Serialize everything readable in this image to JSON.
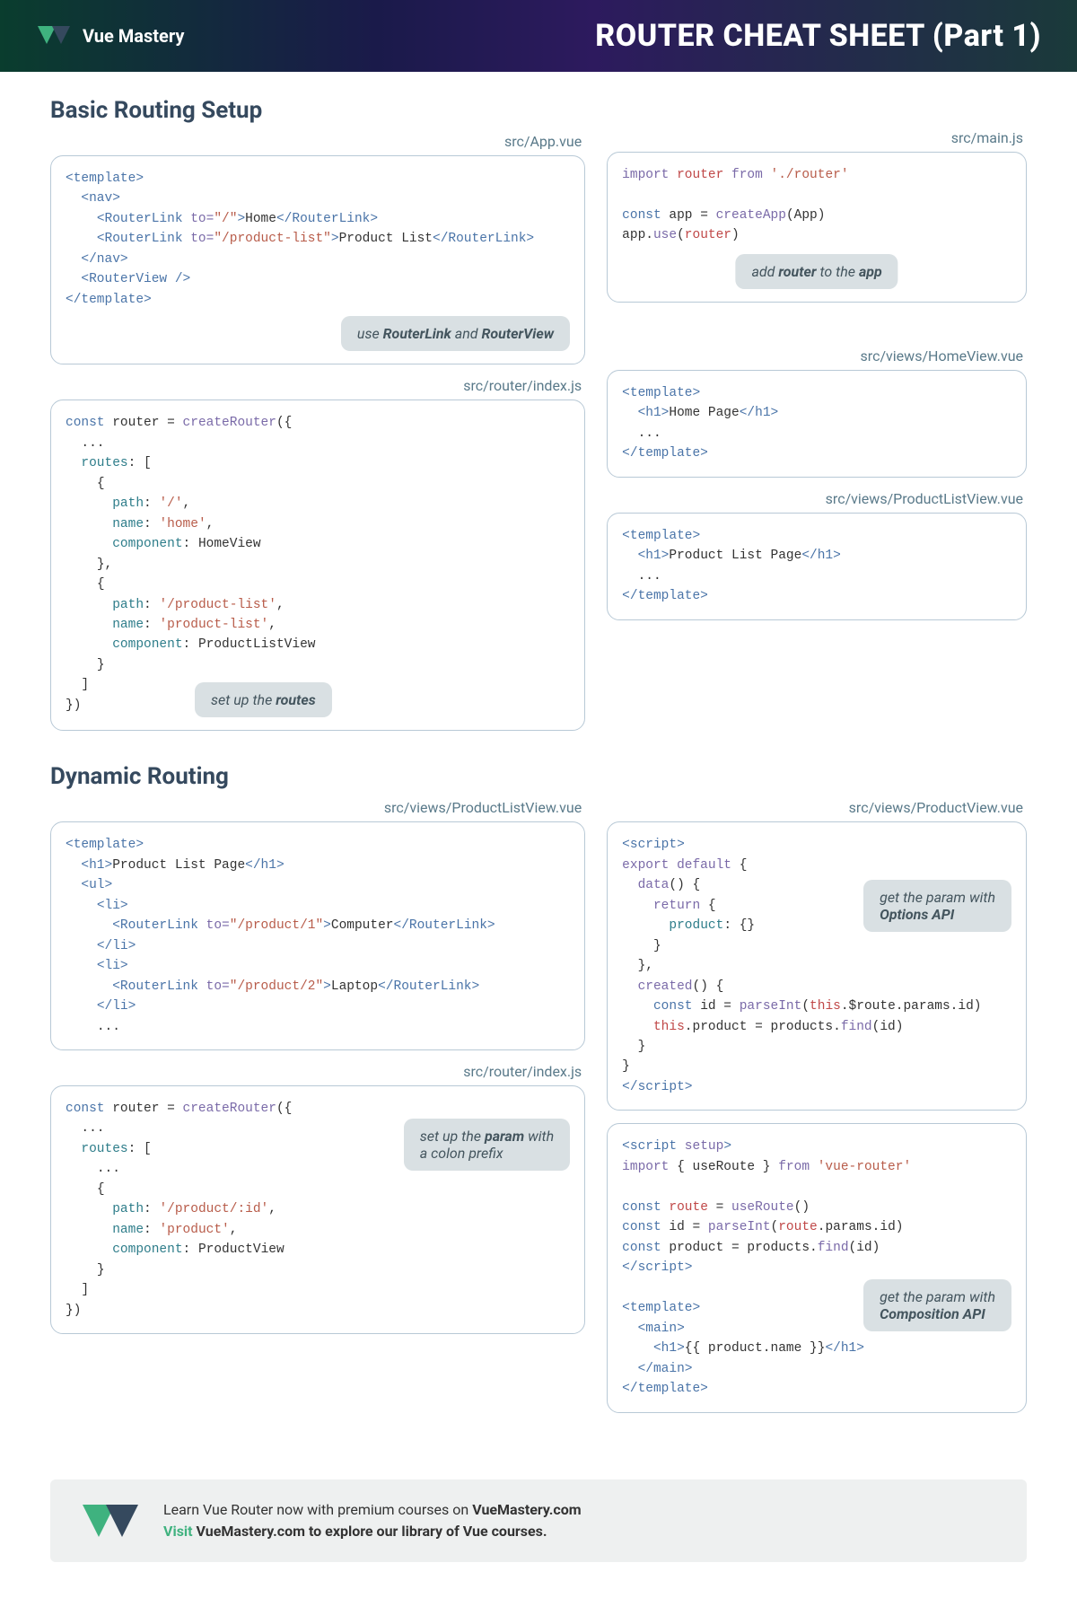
{
  "header": {
    "brand": "Vue Mastery",
    "title": "ROUTER CHEAT SHEET  (Part 1)"
  },
  "basic": {
    "heading": "Basic Routing Setup",
    "files": {
      "app": "src/App.vue",
      "main": "src/main.js",
      "router": "src/router/index.js",
      "home": "src/views/HomeView.vue",
      "plv": "src/views/ProductListView.vue"
    },
    "code": {
      "app": "<template>\n  <nav>\n    <RouterLink to=\"/\">Home</RouterLink>\n    <RouterLink to=\"/product-list\">Product List</RouterLink>\n  </nav>\n  <RouterView />\n</template>",
      "main": "import router from './router'\n\nconst app = createApp(App)\napp.use(router)",
      "router": "const router = createRouter({\n  ...\n  routes: [\n    {\n      path: '/',\n      name: 'home',\n      component: HomeView\n    },\n    {\n      path: '/product-list',\n      name: 'product-list',\n      component: ProductListView\n    }\n  ]\n})",
      "home": "<template>\n  <h1>Home Page</h1>\n  ...\n</template>",
      "plv": "<template>\n  <h1>Product List Page</h1>\n  ...\n</template>"
    },
    "callouts": {
      "rl": "use RouterLink and RouterView",
      "add": "add router to the app",
      "routes": "set up the routes"
    }
  },
  "dynamic": {
    "heading": "Dynamic Routing",
    "files": {
      "plv": "src/views/ProductListView.vue",
      "pv": "src/views/ProductView.vue",
      "router": "src/router/index.js"
    },
    "code": {
      "list": "<template>\n  <h1>Product List Page</h1>\n  <ul>\n    <li>\n      <RouterLink to=\"/product/1\">Computer</RouterLink>\n    </li>\n    <li>\n      <RouterLink to=\"/product/2\">Laptop</RouterLink>\n    </li>\n    ...",
      "router": "const router = createRouter({\n  ...\n  routes: [\n    ...\n    {\n      path: '/product/:id',\n      name: 'product',\n      component: ProductView\n    }\n  ]\n})",
      "options": "<script>\nexport default {\n  data() {\n    return {\n      product: {}\n    }\n  },\n  created() {\n    const id = parseInt(this.$route.params.id)\n    this.product = products.find(id)\n  }\n}\n</script>",
      "composition": "<script setup>\nimport { useRoute } from 'vue-router'\n\nconst route = useRoute()\nconst id = parseInt(route.params.id)\nconst product = products.find(id)\n</script>\n\n<template>\n  <main>\n    <h1>{{ product.name }}</h1>\n  </main>\n</template>"
    },
    "callouts": {
      "param": "set up the param with a colon prefix",
      "options": "get the param with Options API",
      "composition": "get the param with Composition API"
    }
  },
  "footer": {
    "line1": "Learn Vue Router now with premium courses on VueMastery.com",
    "line2_visit": "Visit",
    "line2_rest": " VueMastery.com to explore our library of Vue courses."
  }
}
